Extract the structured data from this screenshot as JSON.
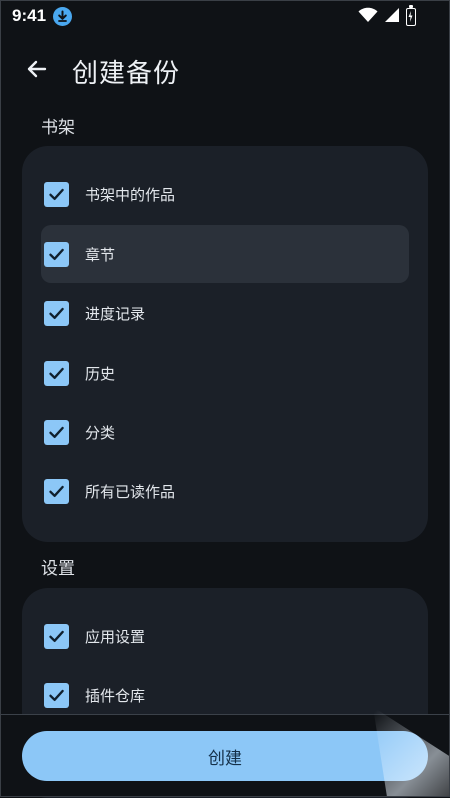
{
  "status_bar": {
    "time": "9:41"
  },
  "app_bar": {
    "title": "创建备份"
  },
  "sections": {
    "library": {
      "header": "书架",
      "options": [
        {
          "label": "书架中的作品",
          "checked": true
        },
        {
          "label": "章节",
          "checked": true
        },
        {
          "label": "进度记录",
          "checked": true
        },
        {
          "label": "历史",
          "checked": true
        },
        {
          "label": "分类",
          "checked": true
        },
        {
          "label": "所有已读作品",
          "checked": true
        }
      ]
    },
    "settings": {
      "header": "设置",
      "options": [
        {
          "label": "应用设置",
          "checked": true
        },
        {
          "label": "插件仓库",
          "checked": true
        }
      ]
    }
  },
  "bottom": {
    "create_label": "创建"
  },
  "colors": {
    "background": "#0f1216",
    "card": "#1b2028",
    "accent": "#8cc7f7",
    "highlight_row": "#2b313a"
  },
  "icons": {
    "back": "arrow-left-icon",
    "check": "check-icon",
    "download": "download-icon",
    "wifi": "wifi-icon",
    "signal": "signal-icon",
    "battery": "battery-icon"
  }
}
